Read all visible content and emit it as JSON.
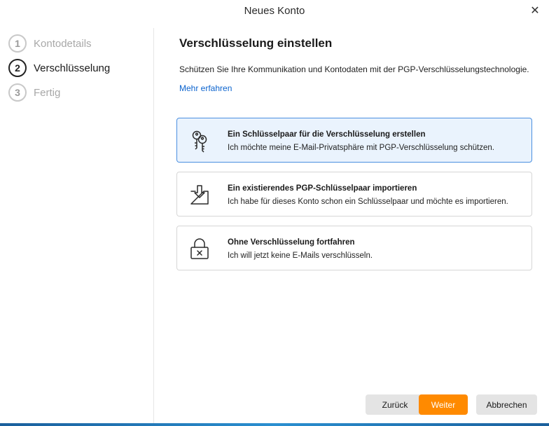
{
  "window": {
    "title": "Neues Konto",
    "close_glyph": "✕"
  },
  "steps": [
    {
      "number": "1",
      "label": "Kontodetails",
      "state": "inactive"
    },
    {
      "number": "2",
      "label": "Verschlüsselung",
      "state": "active"
    },
    {
      "number": "3",
      "label": "Fertig",
      "state": "inactive"
    }
  ],
  "main": {
    "title": "Verschlüsselung einstellen",
    "description": "Schützen Sie Ihre Kommunikation und Kontodaten mit der PGP-Verschlüsselungstechnologie.",
    "learn_more": "Mehr erfahren"
  },
  "options": [
    {
      "icon": "keys-icon",
      "title": "Ein Schlüsselpaar für die Verschlüsselung erstellen",
      "description": "Ich möchte meine E-Mail-Privatsphäre mit PGP-Verschlüsselung schützen.",
      "selected": true
    },
    {
      "icon": "import-icon",
      "title": "Ein existierendes PGP-Schlüsselpaar importieren",
      "description": "Ich habe für dieses Konto schon ein Schlüsselpaar und möchte es importieren.",
      "selected": false
    },
    {
      "icon": "unlocked-icon",
      "title": "Ohne Verschlüsselung fortfahren",
      "description": "Ich will jetzt keine E-Mails verschlüsseln.",
      "selected": false
    }
  ],
  "buttons": {
    "back": "Zurück",
    "next": "Weiter",
    "cancel": "Abbrechen"
  },
  "colors": {
    "accent": "#ff8a00",
    "link": "#0b63ce",
    "selected_border": "#4a8fe0",
    "selected_bg": "#eaf3fd"
  }
}
